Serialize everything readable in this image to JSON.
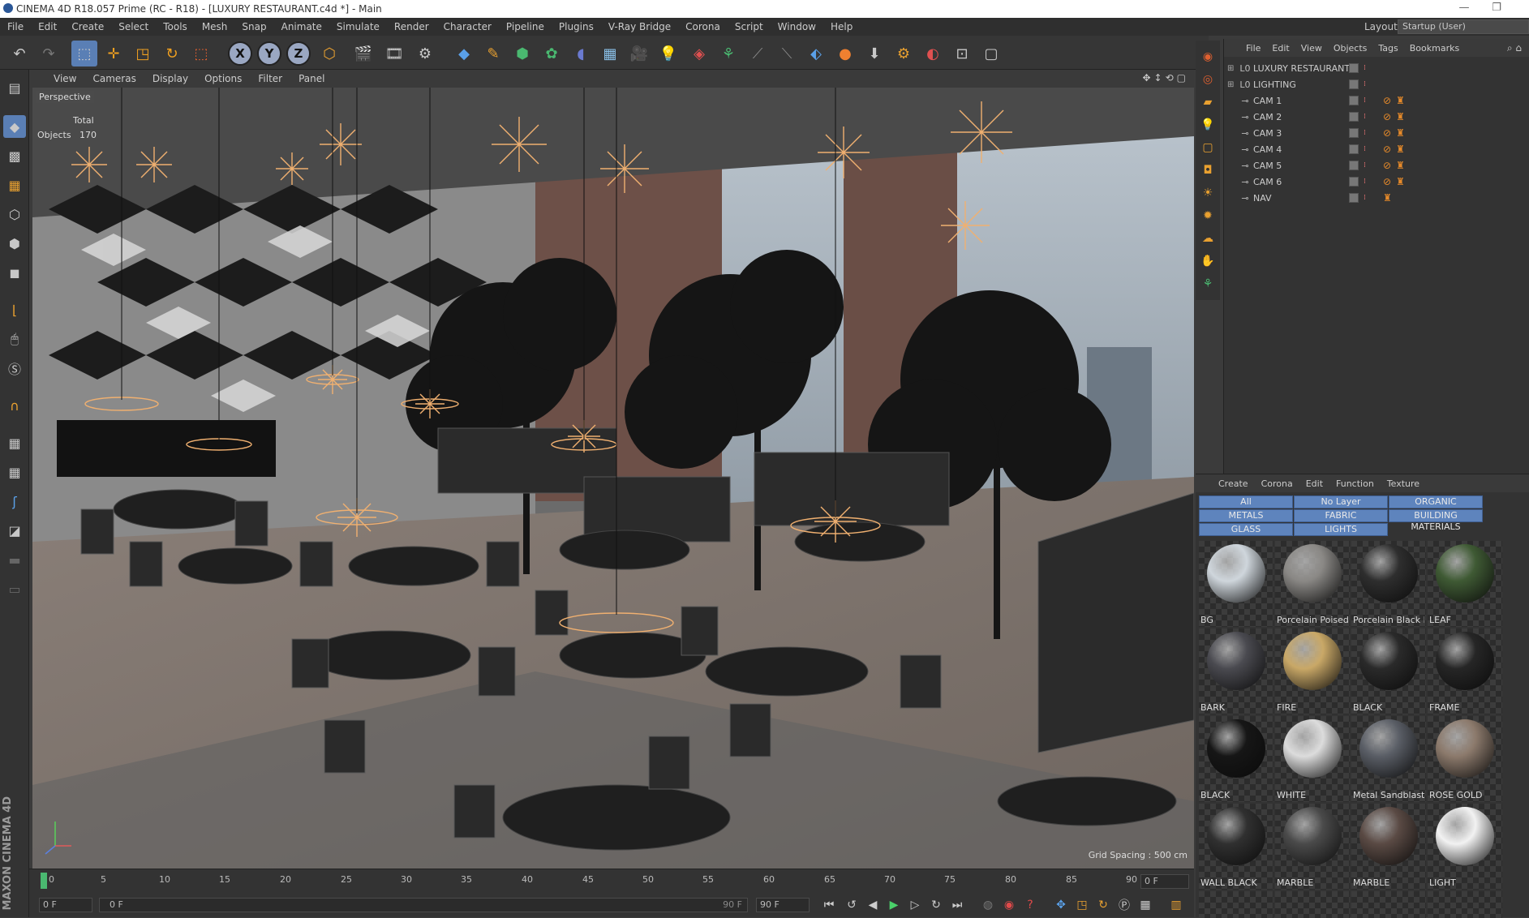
{
  "window": {
    "title": "CINEMA 4D R18.057 Prime (RC - R18) - [LUXURY RESTAURANT.c4d *] - Main"
  },
  "menubar": {
    "items": [
      "File",
      "Edit",
      "Create",
      "Select",
      "Tools",
      "Mesh",
      "Snap",
      "Animate",
      "Simulate",
      "Render",
      "Character",
      "Pipeline",
      "Plugins",
      "V-Ray Bridge",
      "Corona",
      "Script",
      "Window",
      "Help"
    ],
    "layout_label": "Layout:",
    "layout_value": "Startup (User)"
  },
  "toolbar": {
    "axis_x": "X",
    "axis_y": "Y",
    "axis_z": "Z"
  },
  "viewport": {
    "menus": [
      "View",
      "Cameras",
      "Display",
      "Options",
      "Filter",
      "Panel"
    ],
    "camera_label": "Perspective",
    "stats_total": "Total",
    "stats_objects_label": "Objects",
    "stats_objects_value": "170",
    "grid_spacing": "Grid Spacing : 500 cm"
  },
  "timeline": {
    "ticks": [
      "0",
      "5",
      "10",
      "15",
      "20",
      "25",
      "30",
      "35",
      "40",
      "45",
      "50",
      "55",
      "60",
      "65",
      "70",
      "75",
      "80",
      "85",
      "90"
    ],
    "current_frame": "0 F",
    "start_field": "0 F",
    "slider_start": "0 F",
    "slider_end": "90 F",
    "end_field": "90 F"
  },
  "object_manager": {
    "menus": [
      "File",
      "Edit",
      "View",
      "Objects",
      "Tags",
      "Bookmarks"
    ],
    "objects": [
      {
        "name": "LUXURY RESTAURANT",
        "type": "layer-group"
      },
      {
        "name": "LIGHTING",
        "type": "layer-group"
      },
      {
        "name": "CAM 1",
        "type": "camera"
      },
      {
        "name": "CAM 2",
        "type": "camera"
      },
      {
        "name": "CAM 3",
        "type": "camera"
      },
      {
        "name": "CAM 4",
        "type": "camera"
      },
      {
        "name": "CAM 5",
        "type": "camera"
      },
      {
        "name": "CAM 6",
        "type": "camera"
      },
      {
        "name": "NAV",
        "type": "camera"
      }
    ]
  },
  "material_manager": {
    "menus": [
      "Create",
      "Corona",
      "Edit",
      "Function",
      "Texture"
    ],
    "layers": [
      "All",
      "No Layer",
      "ORGANIC",
      "METALS",
      "FABRIC",
      "BUILDING MATERIALS",
      "GLASS",
      "LIGHTS"
    ],
    "materials": [
      {
        "name": "BG",
        "color": "#cfd6dc"
      },
      {
        "name": "Porcelain Poised",
        "color": "#8a8885"
      },
      {
        "name": "Porcelain Black M",
        "color": "#2e2e2e"
      },
      {
        "name": "LEAF",
        "color": "#3f5a34"
      },
      {
        "name": "BARK",
        "color": "#4a4a50"
      },
      {
        "name": "FIRE",
        "color": "#c9a867"
      },
      {
        "name": "BLACK",
        "color": "#2a2a2a"
      },
      {
        "name": "FRAME",
        "color": "#262626"
      },
      {
        "name": "BLACK",
        "color": "#161616"
      },
      {
        "name": "WHITE",
        "color": "#dcdcdc"
      },
      {
        "name": "Metal Sandblaste",
        "color": "#5a5e66"
      },
      {
        "name": "ROSE GOLD",
        "color": "#8c7a6c"
      },
      {
        "name": "WALL BLACK",
        "color": "#303030"
      },
      {
        "name": "MARBLE",
        "color": "#4a4a4a"
      },
      {
        "name": "MARBLE",
        "color": "#5a4a44"
      },
      {
        "name": "LIGHT",
        "color": "#f2f2f2"
      }
    ]
  }
}
